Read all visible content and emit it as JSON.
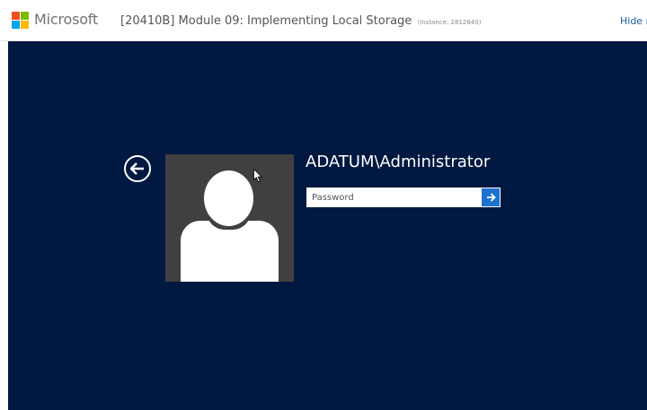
{
  "header": {
    "brand": "Microsoft",
    "lab_title": "[20410B] Module 09: Implementing Local Storage",
    "instance_label": "(Instance: 2812640)",
    "hide_link": "Hide r"
  },
  "login": {
    "username": "ADATUM\\Administrator",
    "password_placeholder": "Password",
    "password_value": "",
    "back_icon": "back-arrow-icon",
    "submit_icon": "right-arrow-icon"
  },
  "colors": {
    "vm_background": "#011840",
    "avatar_background": "#404040",
    "submit_button": "#1e72cf",
    "ms_red": "#f25022",
    "ms_green": "#7fba00",
    "ms_blue": "#00a4ef",
    "ms_yellow": "#ffb900"
  }
}
